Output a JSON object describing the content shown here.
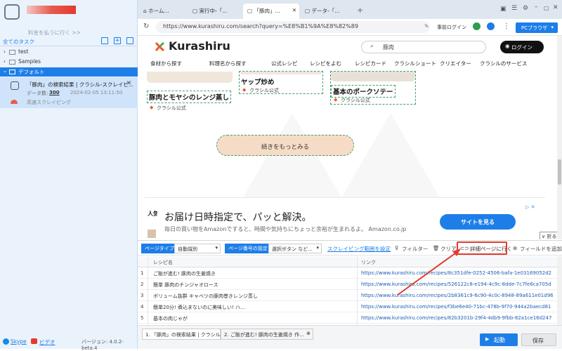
{
  "sidebar": {
    "upgrade_text": "料金を払うに行く >>",
    "all_tasks_label": "全てのタスク",
    "folders": [
      {
        "label": "test"
      },
      {
        "label": "Samples"
      },
      {
        "label": "デフォルト"
      }
    ],
    "task": {
      "title": "「豚肉」の検索結果 | クラシル-スクレイピ...",
      "data_count_label": "データ数:",
      "data_count": "300",
      "timestamp": "2024-02-05 13:11:50",
      "scrape_label": "高速スクレイピング"
    },
    "bottom": {
      "skype_label": "Skype",
      "video_label": "ビデオ",
      "version": "バージョン: 4.0.2-beta.4"
    }
  },
  "browser": {
    "tabs": [
      {
        "label": "ホーム..."
      },
      {
        "label": "実行中-「..."
      },
      {
        "label": "「豚肉」..."
      },
      {
        "label": "データ-「..."
      }
    ],
    "url": "https://www.kurashiru.com/search?query=%E8%B1%9A%E8%82%89",
    "pre_login_label": "事前ログイン",
    "pc_browser_label": "PCブラウザ"
  },
  "site": {
    "logo": "Kurashiru",
    "search_value": "豚肉",
    "login_label": "ログイン",
    "nav": [
      "食材から探す",
      "料理名から探す",
      "公式レシピ",
      "レシピをよむ",
      "レシピカード",
      "クラシルショート",
      "クリエイター",
      "クラシルのサービス"
    ],
    "cards": [
      {
        "title": "豚肉とモヤシのレンジ蒸し",
        "source": "クラシル公式"
      },
      {
        "title": "ヤップ炒め",
        "source": "クラシル公式"
      },
      {
        "title": "基本のポークソテー",
        "source": "クラシル公式"
      }
    ],
    "more_label": "続きをもっとみる",
    "side_text": "人気",
    "ad": {
      "headline": "お届け日時指定で、パッと解決。",
      "subline": "毎日の買い物をAmazonですると、時間や気持ちにちょっと余裕が生まれるよ。 Amazon.co.jp",
      "button": "サイトを見る"
    },
    "fold_label": "折る"
  },
  "toolbar": {
    "page_type_label": "ページタイプ",
    "page_type_value": "自動識別",
    "page_number_label": "ページ番号の設定",
    "page_number_value": "選択ボタン など...",
    "range_label": "スクレイピング範囲を設定",
    "filter_label": "フィルター",
    "clear_label": "クリア",
    "detail_label": "詳細ページに行く",
    "add_field_label": "フィールドを追加"
  },
  "table": {
    "headers": [
      "レシピ名",
      "リンク"
    ],
    "rows": [
      {
        "n": "1",
        "name": "ご飯が進む! 豚肉の生姜焼き",
        "link": "https://www.kurashiru.com/recipes/8c351dfe-0252-4506-bafa-1e03169052d2"
      },
      {
        "n": "2",
        "name": "簡単 豚肉のチンジャオロース",
        "link": "https://www.kurashiru.com/recipes/526122c8-e194-4c9c-8dde-7c7fe6ca705d"
      },
      {
        "n": "3",
        "name": "ボリューム抜群 キャベツの豚肉巻きレンジ蒸し",
        "link": "https://www.kurashiru.com/recipes/2b8361c9-6c90-4c0c-8948-89a611e01d96"
      },
      {
        "n": "4",
        "name": "簡単20分! 煮込まないのに美味しい! ハ...",
        "link": "https://www.kurashiru.com/recipes/f3be6e40-71bc-478b-9f70-944a2baecd81"
      },
      {
        "n": "5",
        "name": "基本の肉じゃが",
        "link": "https://www.kurashiru.com/recipes/82b3201b-29f4-4db9-9fbb-82a1ce16d247"
      }
    ]
  },
  "footer": {
    "tabs": [
      {
        "label": "1. 「豚肉」の検索結果 | クラシル"
      },
      {
        "label": "2. ご飯が進む! 豚肉の生姜焼き 作..."
      }
    ],
    "start_label": "起動",
    "save_label": "保存"
  },
  "colors": {
    "accent": "#1e7ee8",
    "highlight": "#e33b2e"
  }
}
